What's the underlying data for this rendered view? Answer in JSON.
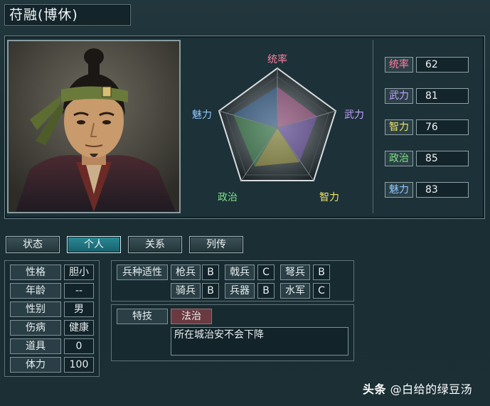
{
  "header": {
    "name": "苻融(博休)"
  },
  "radar": {
    "labels": {
      "command": "统率",
      "war": "武力",
      "intelligence": "智力",
      "politics": "政治",
      "charisma": "魅力"
    },
    "colors": {
      "command": "#ff7fa0",
      "war": "#b890ff",
      "intelligence": "#f1e46a",
      "politics": "#7ee08a",
      "charisma": "#8fc8ff"
    }
  },
  "stats": [
    {
      "label": "统率",
      "value": "62",
      "color": "#ff7fa0"
    },
    {
      "label": "武力",
      "value": "81",
      "color": "#b890ff"
    },
    {
      "label": "智力",
      "value": "76",
      "color": "#f1e46a"
    },
    {
      "label": "政治",
      "value": "85",
      "color": "#7ee08a"
    },
    {
      "label": "魅力",
      "value": "83",
      "color": "#8fc8ff"
    }
  ],
  "tabs": [
    "状态",
    "个人",
    "关系",
    "列传"
  ],
  "active_tab": "个人",
  "personal": [
    {
      "label": "性格",
      "value": "胆小"
    },
    {
      "label": "年龄",
      "value": "--"
    },
    {
      "label": "性别",
      "value": "男"
    },
    {
      "label": "伤病",
      "value": "健康"
    },
    {
      "label": "道具",
      "value": "0"
    },
    {
      "label": "体力",
      "value": "100"
    }
  ],
  "troops": {
    "title": "兵种适性",
    "items": [
      {
        "label": "枪兵",
        "value": "B"
      },
      {
        "label": "戟兵",
        "value": "C"
      },
      {
        "label": "弩兵",
        "value": "B"
      },
      {
        "label": "骑兵",
        "value": "B"
      },
      {
        "label": "兵器",
        "value": "B"
      },
      {
        "label": "水军",
        "value": "C"
      }
    ]
  },
  "skill": {
    "title": "特技",
    "name": "法治",
    "description": "所在城治安不会下降"
  },
  "watermark": {
    "prefix": "头条",
    "text": "@白给的绿豆汤"
  }
}
